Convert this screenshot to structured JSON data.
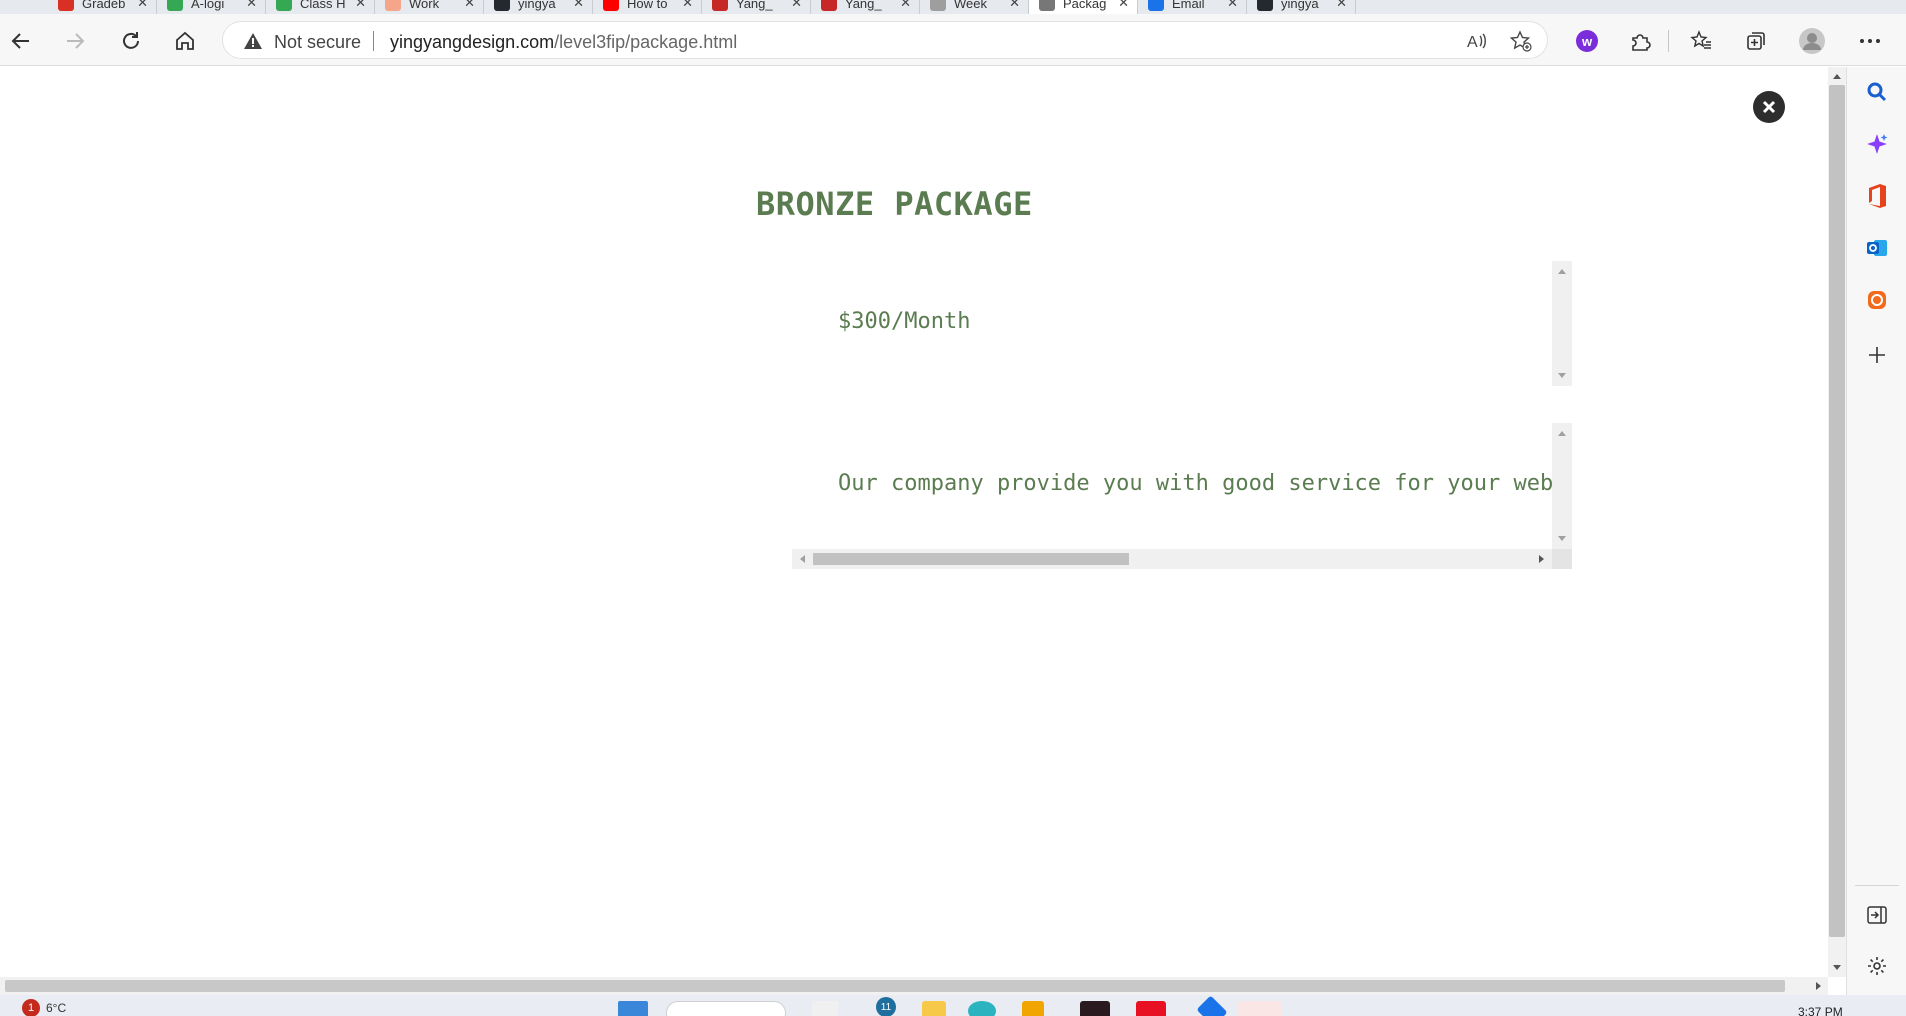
{
  "browser": {
    "tabs": [
      {
        "title": "Gradeb",
        "color": "#d93025",
        "active": false
      },
      {
        "title": "A-logi",
        "color": "#34a853",
        "active": false
      },
      {
        "title": "Class H",
        "color": "#34a853",
        "active": false
      },
      {
        "title": "Work",
        "color": "#f4a58a",
        "active": false
      },
      {
        "title": "yingya",
        "color": "#24292f",
        "active": false
      },
      {
        "title": "How to",
        "color": "#ff0000",
        "active": false
      },
      {
        "title": "Yang_",
        "color": "#c62828",
        "active": false
      },
      {
        "title": "Yang_",
        "color": "#c62828",
        "active": false
      },
      {
        "title": "Week",
        "color": "#9e9e9e",
        "active": false
      },
      {
        "title": "Packag",
        "color": "#777777",
        "active": true
      },
      {
        "title": "Email",
        "color": "#1a73e8",
        "active": false
      },
      {
        "title": "yingya",
        "color": "#24292f",
        "active": false
      }
    ],
    "security_label": "Not secure",
    "url_host": "yingyangdesign.com",
    "url_path": "/level3fip/package.html"
  },
  "page": {
    "title": "BRONZE PACKAGE",
    "price": "$300/Month",
    "description": "Our company provide you with good service for your website",
    "close_icon": "close-circle-icon",
    "description_scroll_position": 0
  },
  "taskbar": {
    "notification_count": "1",
    "temperature": "6°C",
    "edge_badge": "11",
    "time": "3:37 PM"
  },
  "colors": {
    "accent_text": "#5b7c50",
    "scrollbar_thumb": "#c1c1c1"
  }
}
